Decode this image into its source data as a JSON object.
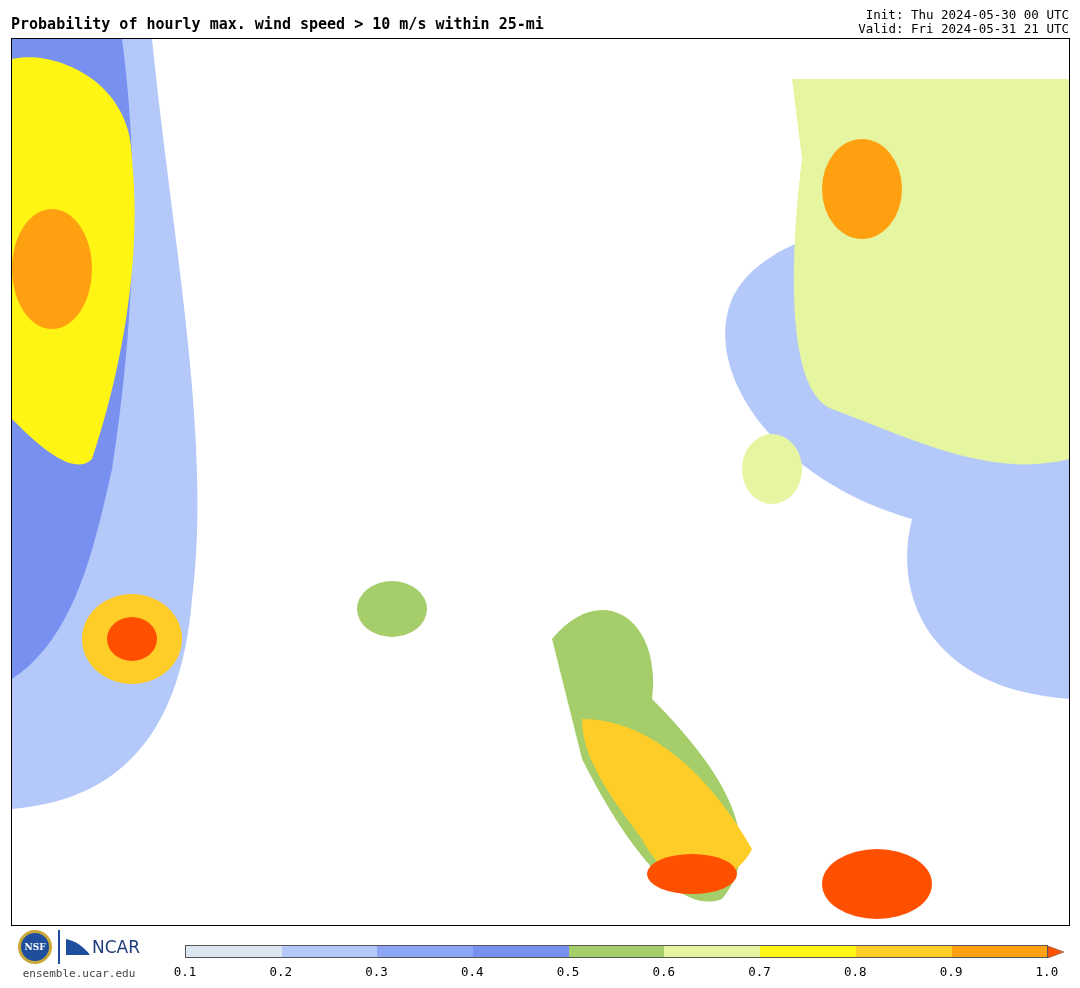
{
  "title": "Probability of hourly max. wind speed > 10 m/s within 25-mi",
  "init": "Init: Thu 2024-05-30 00 UTC",
  "valid": "Valid: Fri 2024-05-31 21 UTC",
  "logos": {
    "nsf": "NSF",
    "ncar": "NCAR",
    "url": "ensemble.ucar.edu"
  },
  "colorbar": {
    "bins": [
      {
        "color": "#dce6f0"
      },
      {
        "color": "#b4c8fa"
      },
      {
        "color": "#8ca5f5"
      },
      {
        "color": "#7890f0"
      },
      {
        "color": "#a5cd69"
      },
      {
        "color": "#e6f5a0"
      },
      {
        "color": "#fff514"
      },
      {
        "color": "#ffcd28"
      },
      {
        "color": "#ffa010"
      }
    ],
    "over": {
      "color": "#ff5000"
    },
    "ticks": [
      "0.1",
      "0.2",
      "0.3",
      "0.4",
      "0.5",
      "0.6",
      "0.7",
      "0.8",
      "0.9",
      "1.0"
    ]
  }
}
